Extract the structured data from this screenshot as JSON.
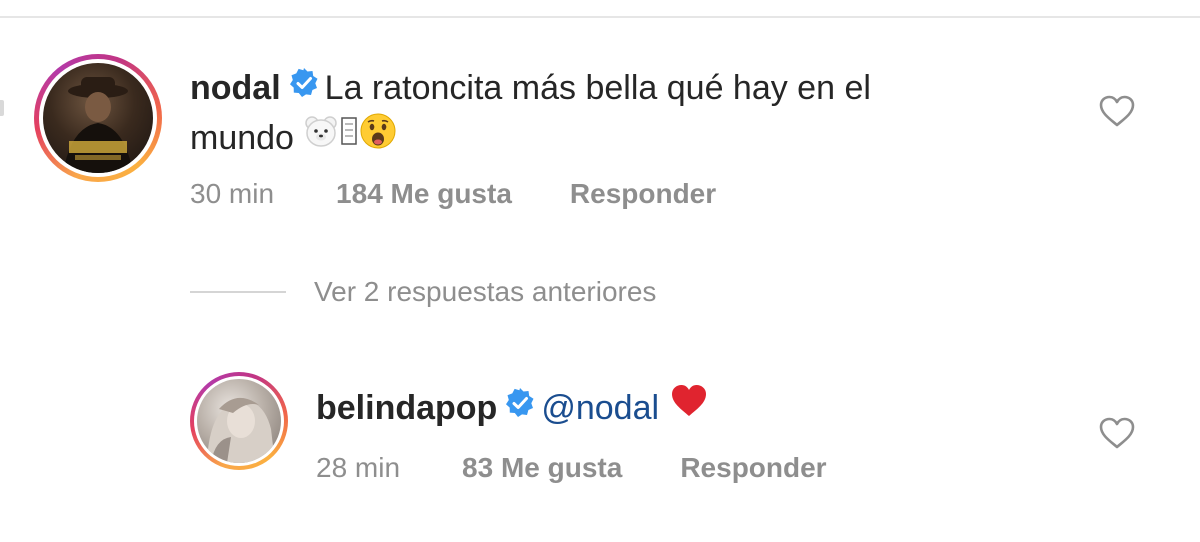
{
  "comments": [
    {
      "username": "nodal",
      "text": "La ratoncita más bella qué hay en el",
      "text_line2": "mundo",
      "emojis": [
        "polar-bear-face",
        "missing-glyph",
        "anguished-face"
      ],
      "time": "30 min",
      "likes": "184 Me gusta",
      "reply": "Responder"
    },
    {
      "username": "belindapop",
      "mention": "@nodal",
      "emojis": [
        "red-heart"
      ],
      "time": "28 min",
      "likes": "83 Me gusta",
      "reply": "Responder"
    }
  ],
  "view_replies": "Ver 2 respuestas anteriores",
  "colors": {
    "text": "#262626",
    "meta": "#8e8e8e",
    "verified": "#3897f0",
    "mention": "#1a4d8f",
    "heart": "#e0242f"
  }
}
